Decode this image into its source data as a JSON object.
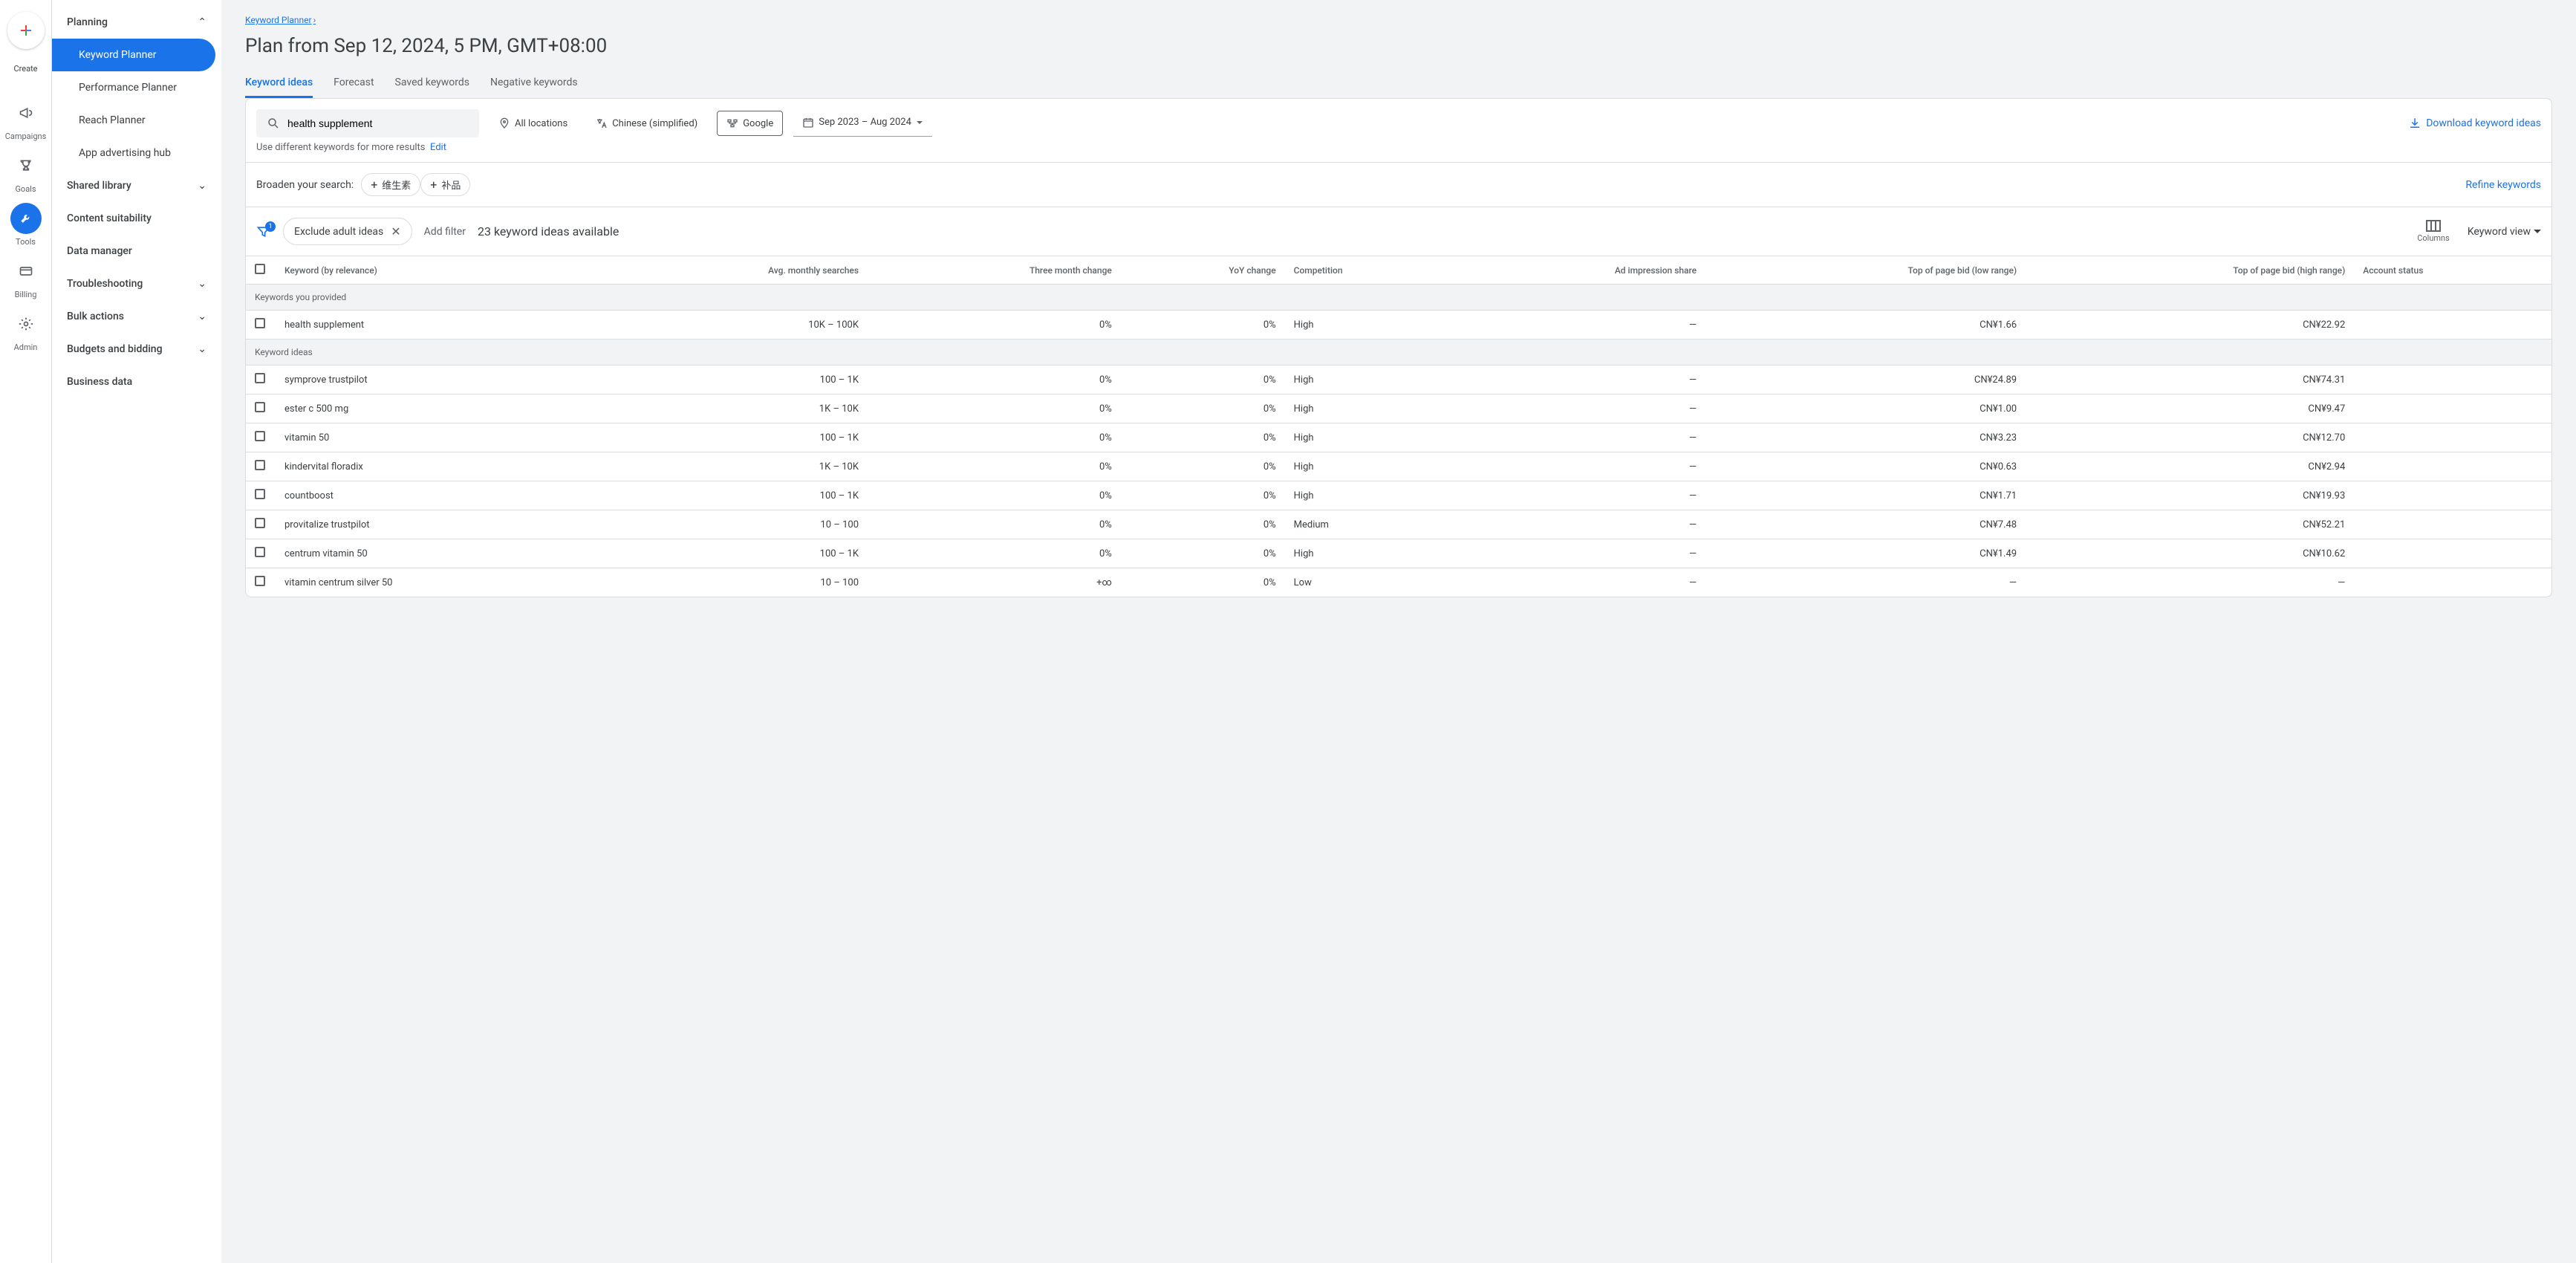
{
  "rail": {
    "create": "Create",
    "items": [
      {
        "label": "Campaigns",
        "icon": "megaphone"
      },
      {
        "label": "Goals",
        "icon": "trophy"
      },
      {
        "label": "Tools",
        "icon": "wrench",
        "active": true
      },
      {
        "label": "Billing",
        "icon": "card"
      },
      {
        "label": "Admin",
        "icon": "gear"
      }
    ]
  },
  "sidebar": {
    "sections": [
      {
        "label": "Planning",
        "expanded": true,
        "items": [
          {
            "label": "Keyword Planner",
            "active": true
          },
          {
            "label": "Performance Planner"
          },
          {
            "label": "Reach Planner"
          },
          {
            "label": "App advertising hub"
          }
        ]
      },
      {
        "label": "Shared library",
        "expanded": false
      },
      {
        "label": "Content suitability",
        "flat": true
      },
      {
        "label": "Data manager",
        "flat": true
      },
      {
        "label": "Troubleshooting",
        "expanded": false
      },
      {
        "label": "Bulk actions",
        "expanded": false
      },
      {
        "label": "Budgets and bidding",
        "expanded": false
      },
      {
        "label": "Business data",
        "flat": true
      }
    ]
  },
  "breadcrumb": "Keyword Planner",
  "page_title": "Plan from Sep 12, 2024, 5 PM, GMT+08:00",
  "tabs": [
    {
      "label": "Keyword ideas",
      "active": true
    },
    {
      "label": "Forecast"
    },
    {
      "label": "Saved keywords"
    },
    {
      "label": "Negative keywords"
    }
  ],
  "filters": {
    "search_value": "health supplement",
    "location": "All locations",
    "language": "Chinese (simplified)",
    "network": "Google",
    "date_range": "Sep 2023 – Aug 2024",
    "download": "Download keyword ideas",
    "hint": "Use different keywords for more results",
    "edit": "Edit"
  },
  "broaden": {
    "label": "Broaden your search:",
    "chips": [
      "维生素",
      "补品"
    ],
    "refine": "Refine keywords"
  },
  "toolbar": {
    "filter_badge": "1",
    "exclude_chip": "Exclude adult ideas",
    "add_filter": "Add filter",
    "ideas_count": "23 keyword ideas available",
    "columns": "Columns",
    "keyword_view": "Keyword view"
  },
  "table": {
    "headers": [
      "Keyword (by relevance)",
      "Avg. monthly searches",
      "Three month change",
      "YoY change",
      "Competition",
      "Ad impression share",
      "Top of page bid (low range)",
      "Top of page bid (high range)",
      "Account status"
    ],
    "section1": "Keywords you provided",
    "rows1": [
      {
        "kw": "health supplement",
        "avg": "10K – 100K",
        "tmc": "0%",
        "yoy": "0%",
        "comp": "High",
        "ais": "—",
        "low": "CN¥1.66",
        "high": "CN¥22.92",
        "acct": ""
      }
    ],
    "section2": "Keyword ideas",
    "rows2": [
      {
        "kw": "symprove trustpilot",
        "avg": "100 – 1K",
        "tmc": "0%",
        "yoy": "0%",
        "comp": "High",
        "ais": "—",
        "low": "CN¥24.89",
        "high": "CN¥74.31",
        "acct": ""
      },
      {
        "kw": "ester c 500 mg",
        "avg": "1K – 10K",
        "tmc": "0%",
        "yoy": "0%",
        "comp": "High",
        "ais": "—",
        "low": "CN¥1.00",
        "high": "CN¥9.47",
        "acct": ""
      },
      {
        "kw": "vitamin 50",
        "avg": "100 – 1K",
        "tmc": "0%",
        "yoy": "0%",
        "comp": "High",
        "ais": "—",
        "low": "CN¥3.23",
        "high": "CN¥12.70",
        "acct": ""
      },
      {
        "kw": "kindervital floradix",
        "avg": "1K – 10K",
        "tmc": "0%",
        "yoy": "0%",
        "comp": "High",
        "ais": "—",
        "low": "CN¥0.63",
        "high": "CN¥2.94",
        "acct": ""
      },
      {
        "kw": "countboost",
        "avg": "100 – 1K",
        "tmc": "0%",
        "yoy": "0%",
        "comp": "High",
        "ais": "—",
        "low": "CN¥1.71",
        "high": "CN¥19.93",
        "acct": ""
      },
      {
        "kw": "provitalize trustpilot",
        "avg": "10 – 100",
        "tmc": "0%",
        "yoy": "0%",
        "comp": "Medium",
        "ais": "—",
        "low": "CN¥7.48",
        "high": "CN¥52.21",
        "acct": ""
      },
      {
        "kw": "centrum vitamin 50",
        "avg": "100 – 1K",
        "tmc": "0%",
        "yoy": "0%",
        "comp": "High",
        "ais": "—",
        "low": "CN¥1.49",
        "high": "CN¥10.62",
        "acct": ""
      },
      {
        "kw": "vitamin centrum silver 50",
        "avg": "10 – 100",
        "tmc": "+∞",
        "yoy": "0%",
        "comp": "Low",
        "ais": "—",
        "low": "—",
        "high": "—",
        "acct": ""
      }
    ]
  }
}
